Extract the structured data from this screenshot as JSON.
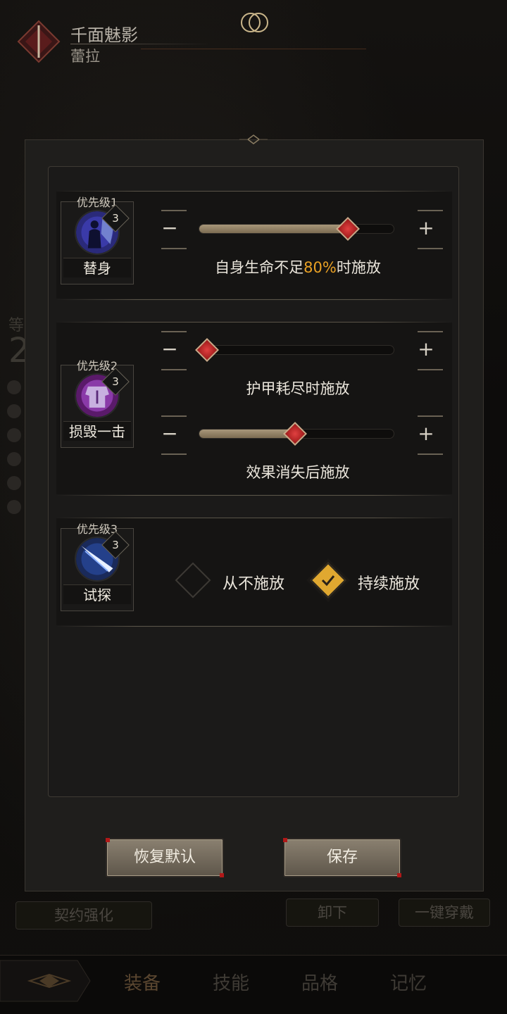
{
  "header": {
    "title": "千面魅影",
    "subtitle": "蕾拉"
  },
  "modal": {
    "rows": [
      {
        "priority": "优先级1",
        "level": "3",
        "skill_name": "替身",
        "sliders": [
          {
            "value": 0.8,
            "caption_prefix": "自身生命不足",
            "caption_highlight": "80%",
            "caption_suffix": "时施放"
          }
        ]
      },
      {
        "priority": "优先级2",
        "level": "3",
        "skill_name": "损毁一击",
        "sliders": [
          {
            "value": 0.0,
            "caption": "护甲耗尽时施放"
          },
          {
            "value": 0.5,
            "caption": "效果消失后施放"
          }
        ]
      },
      {
        "priority": "优先级3",
        "level": "3",
        "skill_name": "试探",
        "options": [
          {
            "label": "从不施放",
            "checked": false
          },
          {
            "label": "持续施放",
            "checked": true
          }
        ]
      }
    ],
    "minus_symbol": "−",
    "plus_symbol": "+",
    "buttons": {
      "reset": "恢复默认",
      "save": "保存"
    }
  },
  "background": {
    "contract_button": "契约强化",
    "unequip_button": "卸下",
    "equip_all_button": "一键穿戴",
    "side_char": "等",
    "side_num": "2"
  },
  "tabs": [
    "装备",
    "技能",
    "品格",
    "记忆"
  ],
  "colors": {
    "highlight": "#e8a024",
    "knob": "#c42020",
    "check": "#e0a830"
  }
}
